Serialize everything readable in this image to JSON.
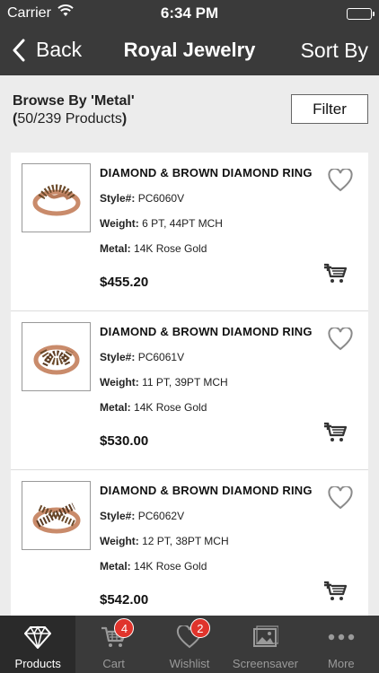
{
  "status": {
    "carrier": "Carrier",
    "time": "6:34 PM"
  },
  "nav": {
    "back_label": "Back",
    "title": "Royal Jewelry",
    "sort_label": "Sort By"
  },
  "browse": {
    "heading": "Browse By 'Metal'",
    "count_open": "(",
    "count_text": "50/239 Products",
    "count_close": ")",
    "filter_label": "Filter"
  },
  "labels": {
    "style": "Style#:",
    "weight": "Weight:",
    "metal": "Metal:"
  },
  "products": [
    {
      "name": "DIAMOND & BROWN DIAMOND RING",
      "style": "PC6060V",
      "weight": "6 PT, 44PT MCH",
      "metal": "14K Rose Gold",
      "price": "$455.20"
    },
    {
      "name": "DIAMOND & BROWN DIAMOND RING",
      "style": "PC6061V",
      "weight": "11 PT, 39PT MCH",
      "metal": "14K Rose Gold",
      "price": "$530.00"
    },
    {
      "name": "DIAMOND & BROWN DIAMOND RING",
      "style": "PC6062V",
      "weight": "12 PT, 38PT MCH",
      "metal": "14K Rose Gold",
      "price": "$542.00"
    }
  ],
  "tabs": [
    {
      "label": "Products",
      "icon": "diamond-icon",
      "active": true
    },
    {
      "label": "Cart",
      "icon": "cart-icon",
      "badge": "4"
    },
    {
      "label": "Wishlist",
      "icon": "heart-icon",
      "badge": "2"
    },
    {
      "label": "Screensaver",
      "icon": "image-icon"
    },
    {
      "label": "More",
      "icon": "more-icon"
    }
  ],
  "colors": {
    "bar": "#3a3a3a",
    "badge": "#e0342c",
    "background": "#ececec"
  }
}
